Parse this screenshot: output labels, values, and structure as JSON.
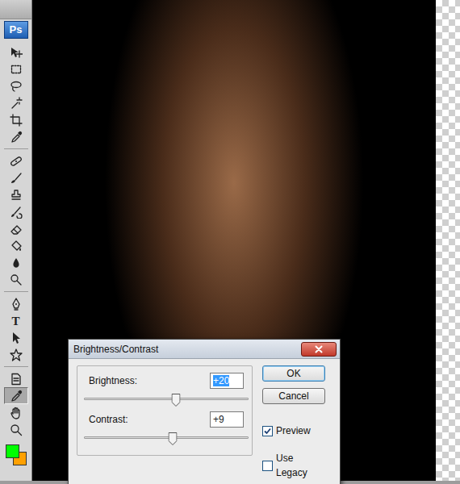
{
  "app": {
    "logo": "Ps"
  },
  "tool_groups": [
    [
      {
        "kind": "move",
        "selected": false
      },
      {
        "kind": "marquee",
        "selected": false
      },
      {
        "kind": "lasso",
        "selected": false
      },
      {
        "kind": "wand",
        "selected": false
      },
      {
        "kind": "crop",
        "selected": false
      },
      {
        "kind": "eyedropper",
        "selected": false
      }
    ],
    [
      {
        "kind": "heal",
        "selected": false
      },
      {
        "kind": "brush",
        "selected": false
      },
      {
        "kind": "stamp",
        "selected": false
      },
      {
        "kind": "history",
        "selected": false
      },
      {
        "kind": "eraser",
        "selected": false
      },
      {
        "kind": "bucket",
        "selected": false
      },
      {
        "kind": "blur",
        "selected": false
      },
      {
        "kind": "dodge",
        "selected": false
      }
    ],
    [
      {
        "kind": "pen",
        "selected": false
      },
      {
        "kind": "type",
        "glyph": "T",
        "selected": false
      },
      {
        "kind": "select",
        "selected": false
      },
      {
        "kind": "shape",
        "selected": false
      }
    ],
    [
      {
        "kind": "notes",
        "selected": false
      },
      {
        "kind": "eyedropper",
        "selected": true
      },
      {
        "kind": "hand",
        "selected": false
      },
      {
        "kind": "zoom",
        "selected": false
      }
    ]
  ],
  "swatches": [
    {
      "name": "foreground",
      "color": "#00ff00"
    },
    {
      "name": "background",
      "color": "#ffa000"
    }
  ],
  "dialog": {
    "title": "Brightness/Contrast",
    "fields": [
      {
        "label": "Brightness:",
        "value": "+20",
        "selected": true,
        "level": 0.56
      },
      {
        "label": "Contrast:",
        "value": "+9",
        "selected": false,
        "level": 0.54
      }
    ],
    "buttons": [
      {
        "label": "OK",
        "default": true
      },
      {
        "label": "Cancel",
        "default": false
      }
    ],
    "options": [
      {
        "label": "Preview",
        "checked": true
      },
      {
        "label": "Use Legacy",
        "checked": false
      }
    ]
  }
}
